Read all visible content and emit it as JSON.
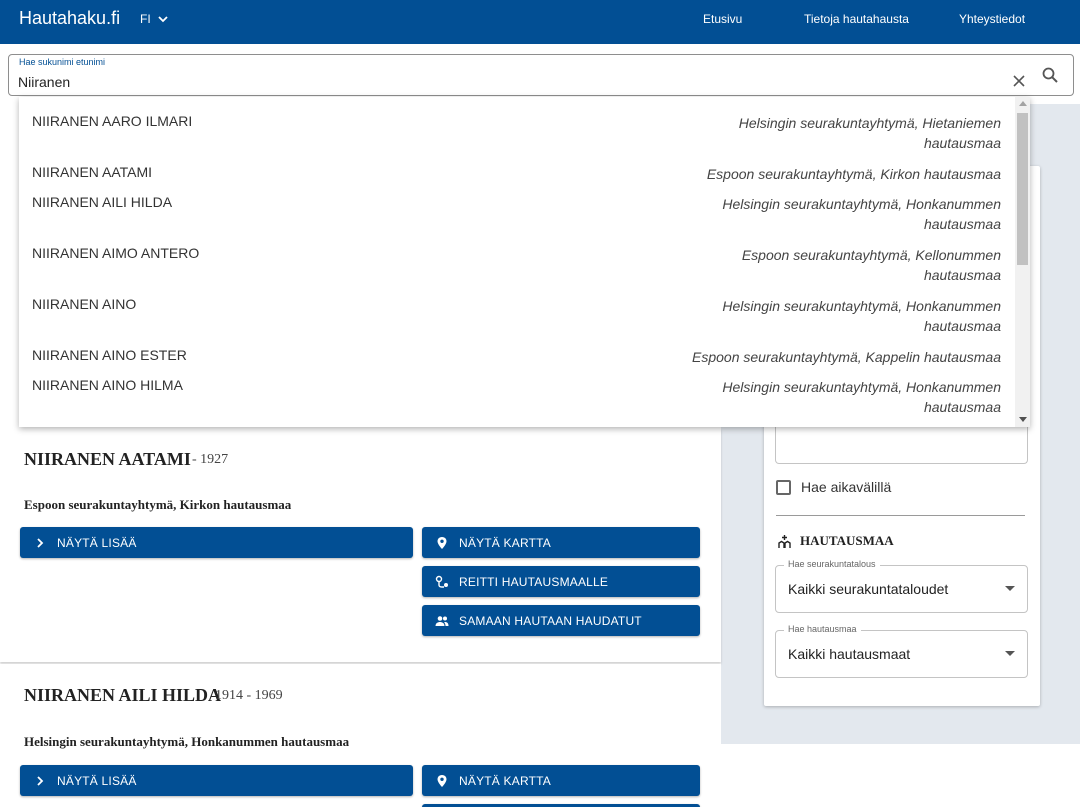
{
  "header": {
    "brand": "Hautahaku.fi",
    "language": "FI",
    "nav": [
      "Etusivu",
      "Tietoja hautahausta",
      "Yhteystiedot"
    ]
  },
  "search": {
    "label": "Hae sukunimi etunimi",
    "value": "Niiranen"
  },
  "suggestions": [
    {
      "name": "NIIRANEN AARO ILMARI",
      "place": "Helsingin seurakuntayhtymä, Hietaniemen hautausmaa"
    },
    {
      "name": "NIIRANEN AATAMI",
      "place": "Espoon seurakuntayhtymä, Kirkon hautausmaa"
    },
    {
      "name": "NIIRANEN AILI HILDA",
      "place": "Helsingin seurakuntayhtymä, Honkanummen hautausmaa"
    },
    {
      "name": "NIIRANEN AIMO ANTERO",
      "place": "Espoon seurakuntayhtymä, Kellonummen hautausmaa"
    },
    {
      "name": "NIIRANEN AINO",
      "place": "Helsingin seurakuntayhtymä, Honkanummen hautausmaa"
    },
    {
      "name": "NIIRANEN AINO ESTER",
      "place": "Espoon seurakuntayhtymä, Kappelin hautausmaa"
    },
    {
      "name": "NIIRANEN AINO HILMA",
      "place": "Helsingin seurakuntayhtymä, Honkanummen hautausmaa"
    }
  ],
  "results": [
    {
      "name": "NIIRANEN AATAMI",
      "years": "- 1927",
      "place": "Espoon seurakuntayhtymä, Kirkon hautausmaa"
    },
    {
      "name": "NIIRANEN AILI HILDA",
      "years": "1914 - 1969",
      "place": "Helsingin seurakuntayhtymä, Honkanummen hautausmaa"
    }
  ],
  "buttons": {
    "more": "NÄYTÄ LISÄÄ",
    "map": "NÄYTÄ KARTTA",
    "route": "REITTI HAUTAUSMAALLE",
    "same_grave": "SAMAAN HAUTAAN HAUDATUT"
  },
  "filters": {
    "date_range_label": "Hae aikavälillä",
    "cemetery_section": "HAUTAUSMAA",
    "parish_label": "Hae seurakuntatalous",
    "parish_value": "Kaikki seurakuntataloudet",
    "cemetery_label": "Hae hautausmaa",
    "cemetery_value": "Kaikki hautausmaat"
  },
  "colors": {
    "primary": "#024f94",
    "panel_bg": "#e3e8ee"
  }
}
